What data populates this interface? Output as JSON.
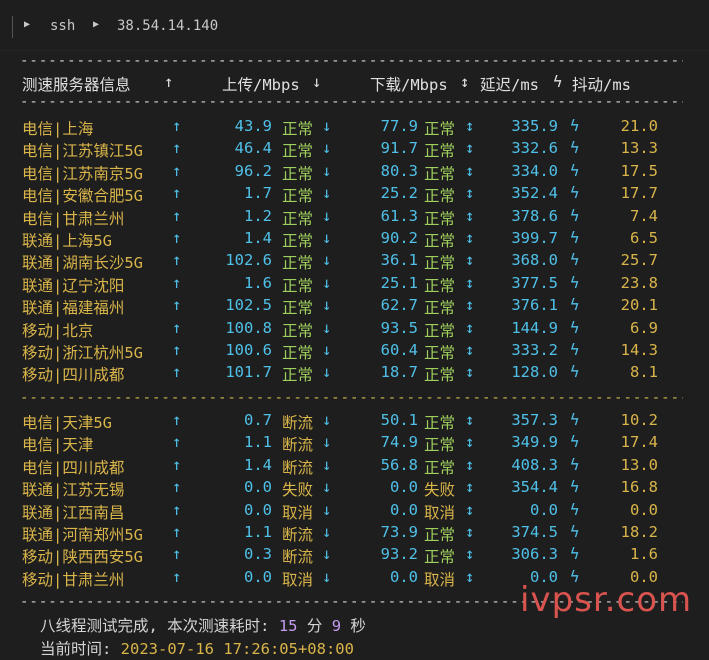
{
  "breadcrumb": {
    "item1": "ssh",
    "item2": "38.54.14.140"
  },
  "header": {
    "col_server": "测速服务器信息",
    "col_upload": "上传/Mbps",
    "col_download": "下载/Mbps",
    "col_latency": "延迟/ms",
    "col_jitter": "抖动/ms"
  },
  "group1": [
    {
      "name": "电信|上海",
      "up": "43.9",
      "ups": "正常",
      "down": "77.9",
      "downs": "正常",
      "lat": "335.9",
      "jit": "21.0"
    },
    {
      "name": "电信|江苏镇江5G",
      "up": "46.4",
      "ups": "正常",
      "down": "91.7",
      "downs": "正常",
      "lat": "332.6",
      "jit": "13.3"
    },
    {
      "name": "电信|江苏南京5G",
      "up": "96.2",
      "ups": "正常",
      "down": "80.3",
      "downs": "正常",
      "lat": "334.0",
      "jit": "17.5"
    },
    {
      "name": "电信|安徽合肥5G",
      "up": "1.7",
      "ups": "正常",
      "down": "25.2",
      "downs": "正常",
      "lat": "352.4",
      "jit": "17.7"
    },
    {
      "name": "电信|甘肃兰州",
      "up": "1.2",
      "ups": "正常",
      "down": "61.3",
      "downs": "正常",
      "lat": "378.6",
      "jit": "7.4"
    },
    {
      "name": "联通|上海5G",
      "up": "1.4",
      "ups": "正常",
      "down": "90.2",
      "downs": "正常",
      "lat": "399.7",
      "jit": "6.5"
    },
    {
      "name": "联通|湖南长沙5G",
      "up": "102.6",
      "ups": "正常",
      "down": "36.1",
      "downs": "正常",
      "lat": "368.0",
      "jit": "25.7"
    },
    {
      "name": "联通|辽宁沈阳",
      "up": "1.6",
      "ups": "正常",
      "down": "25.1",
      "downs": "正常",
      "lat": "377.5",
      "jit": "23.8"
    },
    {
      "name": "联通|福建福州",
      "up": "102.5",
      "ups": "正常",
      "down": "62.7",
      "downs": "正常",
      "lat": "376.1",
      "jit": "20.1"
    },
    {
      "name": "移动|北京",
      "up": "100.8",
      "ups": "正常",
      "down": "93.5",
      "downs": "正常",
      "lat": "144.9",
      "jit": "6.9"
    },
    {
      "name": "移动|浙江杭州5G",
      "up": "100.6",
      "ups": "正常",
      "down": "60.4",
      "downs": "正常",
      "lat": "333.2",
      "jit": "14.3"
    },
    {
      "name": "移动|四川成都",
      "up": "101.7",
      "ups": "正常",
      "down": "18.7",
      "downs": "正常",
      "lat": "128.0",
      "jit": "8.1"
    }
  ],
  "group2": [
    {
      "name": "电信|天津5G",
      "up": "0.7",
      "ups": "断流",
      "down": "50.1",
      "downs": "正常",
      "lat": "357.3",
      "jit": "10.2"
    },
    {
      "name": "电信|天津",
      "up": "1.1",
      "ups": "断流",
      "down": "74.9",
      "downs": "正常",
      "lat": "349.9",
      "jit": "17.4"
    },
    {
      "name": "电信|四川成都",
      "up": "1.4",
      "ups": "断流",
      "down": "56.8",
      "downs": "正常",
      "lat": "408.3",
      "jit": "13.0"
    },
    {
      "name": "联通|江苏无锡",
      "up": "0.0",
      "ups": "失败",
      "down": "0.0",
      "downs": "失败",
      "lat": "354.4",
      "jit": "16.8"
    },
    {
      "name": "联通|江西南昌",
      "up": "0.0",
      "ups": "取消",
      "down": "0.0",
      "downs": "取消",
      "lat": "0.0",
      "jit": "0.0"
    },
    {
      "name": "联通|河南郑州5G",
      "up": "1.1",
      "ups": "断流",
      "down": "73.9",
      "downs": "正常",
      "lat": "374.5",
      "jit": "18.2"
    },
    {
      "name": "移动|陕西西安5G",
      "up": "0.3",
      "ups": "断流",
      "down": "93.2",
      "downs": "正常",
      "lat": "306.3",
      "jit": "1.6"
    },
    {
      "name": "移动|甘肃兰州",
      "up": "0.0",
      "ups": "取消",
      "down": "0.0",
      "downs": "取消",
      "lat": "0.0",
      "jit": "0.0"
    }
  ],
  "footer": {
    "done_prefix": "八线程测试完成, 本次测速耗时: ",
    "minutes": "15",
    "minutes_unit": " 分 ",
    "seconds": "9",
    "seconds_unit": " 秒",
    "time_label": "当前时间: ",
    "time_value": "2023-07-16 17:26:05+08:00"
  },
  "watermark": "ivpsr.com",
  "colors": {
    "accent": "#4fc1e9",
    "name": "#d9b54a",
    "ok": "#9fcf5c",
    "purple": "#c49cf0",
    "watermark": "#d9534f"
  }
}
